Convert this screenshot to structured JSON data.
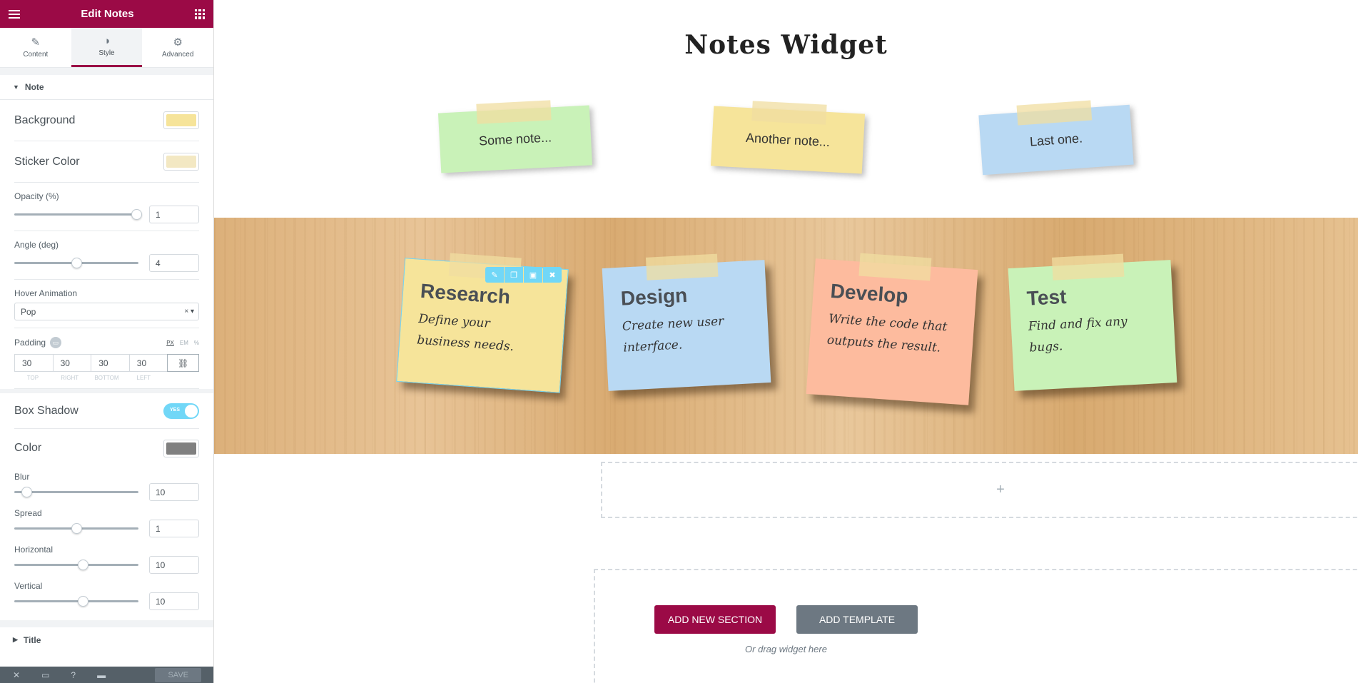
{
  "panel": {
    "title": "Edit Notes",
    "tabs": [
      {
        "label": "Content",
        "icon": "pencil-icon"
      },
      {
        "label": "Style",
        "icon": "contrast-icon"
      },
      {
        "label": "Advanced",
        "icon": "gear-icon"
      }
    ],
    "active_tab": "Style",
    "section_title": "Note",
    "background_label": "Background",
    "background_color": "#f6e49a",
    "sticker_label": "Sticker Color",
    "sticker_color": "#f3e8c3",
    "opacity_label": "Opacity (%)",
    "opacity_value": "1",
    "opacity_level": 0.98,
    "angle_label": "Angle (deg)",
    "angle_value": "4",
    "angle_level": 0.5,
    "hover_label": "Hover Animation",
    "hover_value": "Pop",
    "padding_label": "Padding",
    "padding_units": [
      "PX",
      "EM",
      "%"
    ],
    "padding_values": [
      "30",
      "30",
      "30",
      "30"
    ],
    "padding_sides": [
      "TOP",
      "RIGHT",
      "BOTTOM",
      "LEFT"
    ],
    "box_shadow_label": "Box Shadow",
    "box_shadow_toggle": "YES",
    "shadow_color_label": "Color",
    "shadow_color": "#808080",
    "blur_label": "Blur",
    "blur_value": "10",
    "blur_level": 0.1,
    "spread_label": "Spread",
    "spread_value": "1",
    "spread_level": 0.5,
    "horizontal_label": "Horizontal",
    "horizontal_value": "10",
    "horizontal_level": 0.55,
    "vertical_label": "Vertical",
    "vertical_value": "10",
    "vertical_level": 0.55,
    "next_section_title": "Title",
    "footer_save": "SAVE"
  },
  "canvas": {
    "page_title": "Notes Widget",
    "small_notes": [
      {
        "text": "Some note...",
        "color": "#c9f2b8"
      },
      {
        "text": "Another note...",
        "color": "#f6e49a"
      },
      {
        "text": "Last one.",
        "color": "#b9d9f3"
      }
    ],
    "large_notes": [
      {
        "title": "Research",
        "body": "Define your business needs.",
        "color": "#f6e49a"
      },
      {
        "title": "Design",
        "body": "Create new user interface.",
        "color": "#b9d9f3"
      },
      {
        "title": "Develop",
        "body": "Write the code that outputs the result.",
        "color": "#fdbb9e"
      },
      {
        "title": "Test",
        "body": "Find and fix any bugs.",
        "color": "#c9f2b8"
      }
    ],
    "add_plus": "+",
    "add_section": "ADD NEW SECTION",
    "add_template": "ADD TEMPLATE",
    "drag_hint": "Or drag widget here"
  }
}
